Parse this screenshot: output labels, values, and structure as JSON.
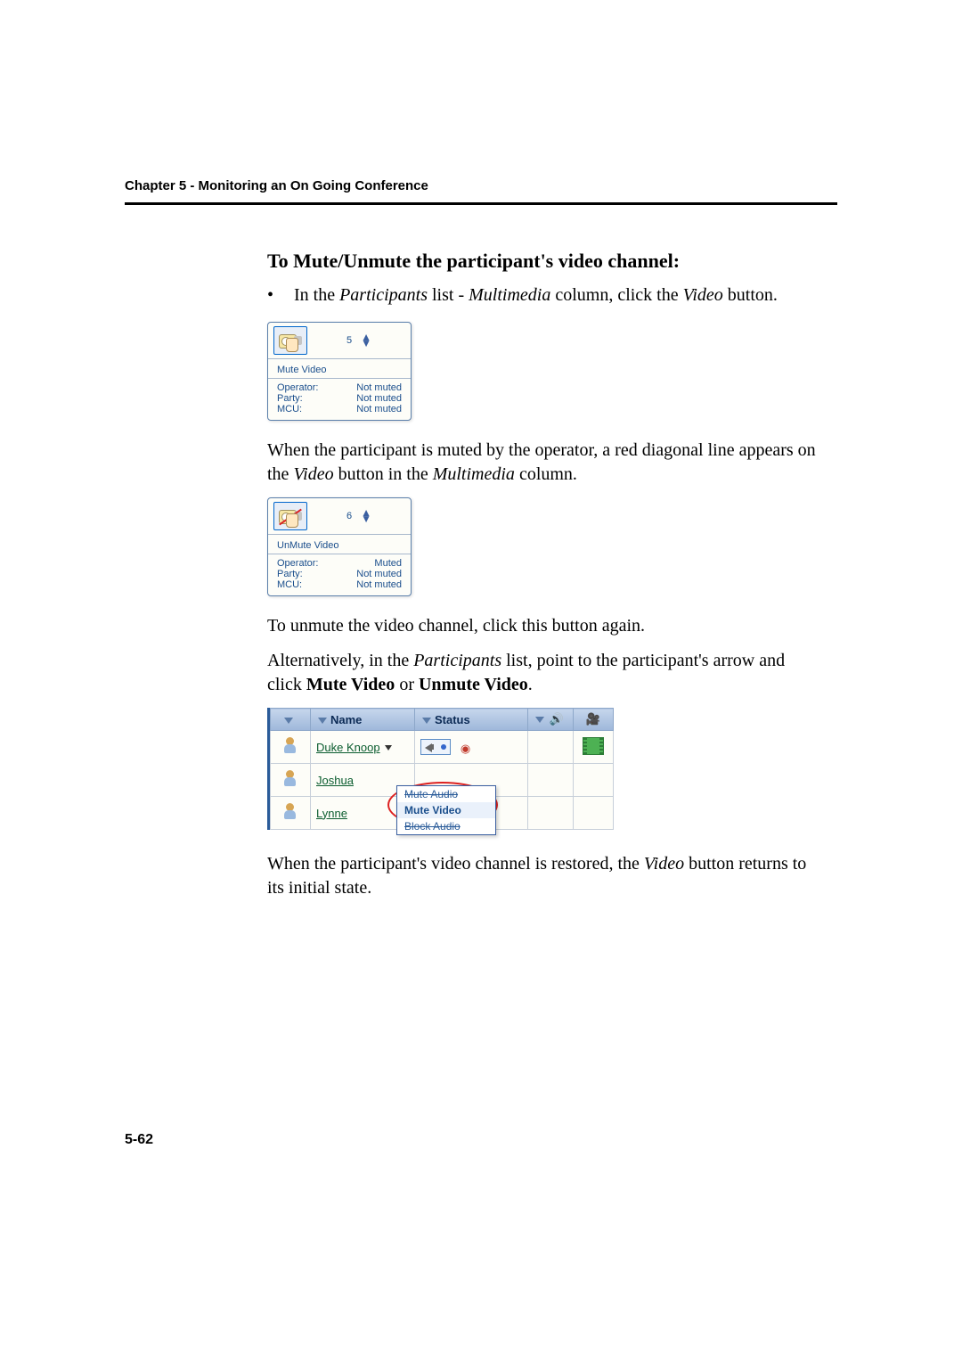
{
  "chapter_header": "Chapter 5 - Monitoring an On Going Conference",
  "section_title": "To Mute/Unmute the participant's video channel:",
  "bullet": {
    "pre": "In the ",
    "i1": "Participants",
    "mid1": " list - ",
    "i2": "Multimedia",
    "mid2": " column, click the ",
    "i3": "Video",
    "post": " button."
  },
  "tooltip1": {
    "count": "5",
    "title": "Mute Video",
    "rows": [
      {
        "k": "Operator:",
        "v": "Not muted"
      },
      {
        "k": "Party:",
        "v": "Not muted"
      },
      {
        "k": "MCU:",
        "v": "Not muted"
      }
    ]
  },
  "para1": {
    "pre": "When the participant is muted by the operator, a red diagonal line appears on the ",
    "i1": "Video",
    "mid": " button in the ",
    "i2": "Multimedia",
    "post": " column."
  },
  "tooltip2": {
    "count": "6",
    "title": "UnMute Video",
    "rows": [
      {
        "k": "Operator:",
        "v": "Muted"
      },
      {
        "k": "Party:",
        "v": "Not muted"
      },
      {
        "k": "MCU:",
        "v": "Not muted"
      }
    ]
  },
  "para2": "To unmute the video channel, click this button again.",
  "para3": {
    "pre": "Alternatively, in the ",
    "i1": "Participants",
    "mid1": " list, point to the participant's arrow and click ",
    "b1": "Mute Video",
    "mid2": " or ",
    "b2": "Unmute Video",
    "post": "."
  },
  "ptable": {
    "headers": {
      "name": "Name",
      "status": "Status"
    },
    "rows": [
      {
        "name": "Duke Knoop"
      },
      {
        "name": "Joshua"
      },
      {
        "name": "Lynne"
      }
    ],
    "menu": {
      "struck1": "Mute Audio",
      "active": "Mute Video",
      "struck2": "Block Audio"
    }
  },
  "para4": {
    "pre": "When the participant's video channel is restored, the ",
    "i1": "Video",
    "post": " button returns to its initial state."
  },
  "page_number": "5-62"
}
